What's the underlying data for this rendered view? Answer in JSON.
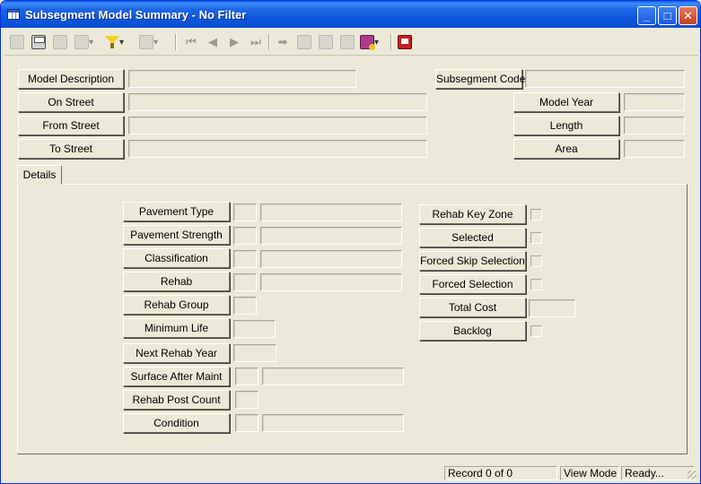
{
  "window": {
    "title": "Subsegment Model Summary - No Filter",
    "minimize_glyph": "_",
    "maximize_glyph": "□",
    "close_glyph": "✕"
  },
  "toolbar": {
    "nav_first": "⏮",
    "nav_prev": "◀",
    "nav_next": "▶",
    "nav_last": "⏭",
    "goto": "➡",
    "dropdown_glyph": "▾"
  },
  "header": {
    "model_description": {
      "label": "Model Description",
      "value": ""
    },
    "subsegment_code": {
      "label": "Subsegment Code",
      "value": ""
    },
    "on_street": {
      "label": "On Street",
      "value": ""
    },
    "model_year": {
      "label": "Model Year",
      "value": ""
    },
    "from_street": {
      "label": "From Street",
      "value": ""
    },
    "length": {
      "label": "Length",
      "value": ""
    },
    "to_street": {
      "label": "To Street",
      "value": ""
    },
    "area": {
      "label": "Area",
      "value": ""
    }
  },
  "tabs": [
    {
      "label": "Details"
    }
  ],
  "details": {
    "pavement_type": "Pavement Type",
    "pavement_strength": "Pavement Strength",
    "classification": "Classification",
    "rehab": "Rehab",
    "rehab_group": "Rehab Group",
    "minimum_life": "Minimum Life",
    "next_rehab_year": "Next Rehab Year",
    "surface_after_maint": "Surface After Maint",
    "rehab_post_count": "Rehab Post Count",
    "condition": "Condition",
    "rehab_key_zone": "Rehab Key Zone",
    "selected": "Selected",
    "forced_skip_selection": "Forced Skip Selection",
    "forced_selection": "Forced Selection",
    "total_cost": "Total Cost",
    "backlog": "Backlog"
  },
  "status": {
    "record": "Record 0 of 0",
    "mode": "View Mode",
    "state": "Ready..."
  }
}
